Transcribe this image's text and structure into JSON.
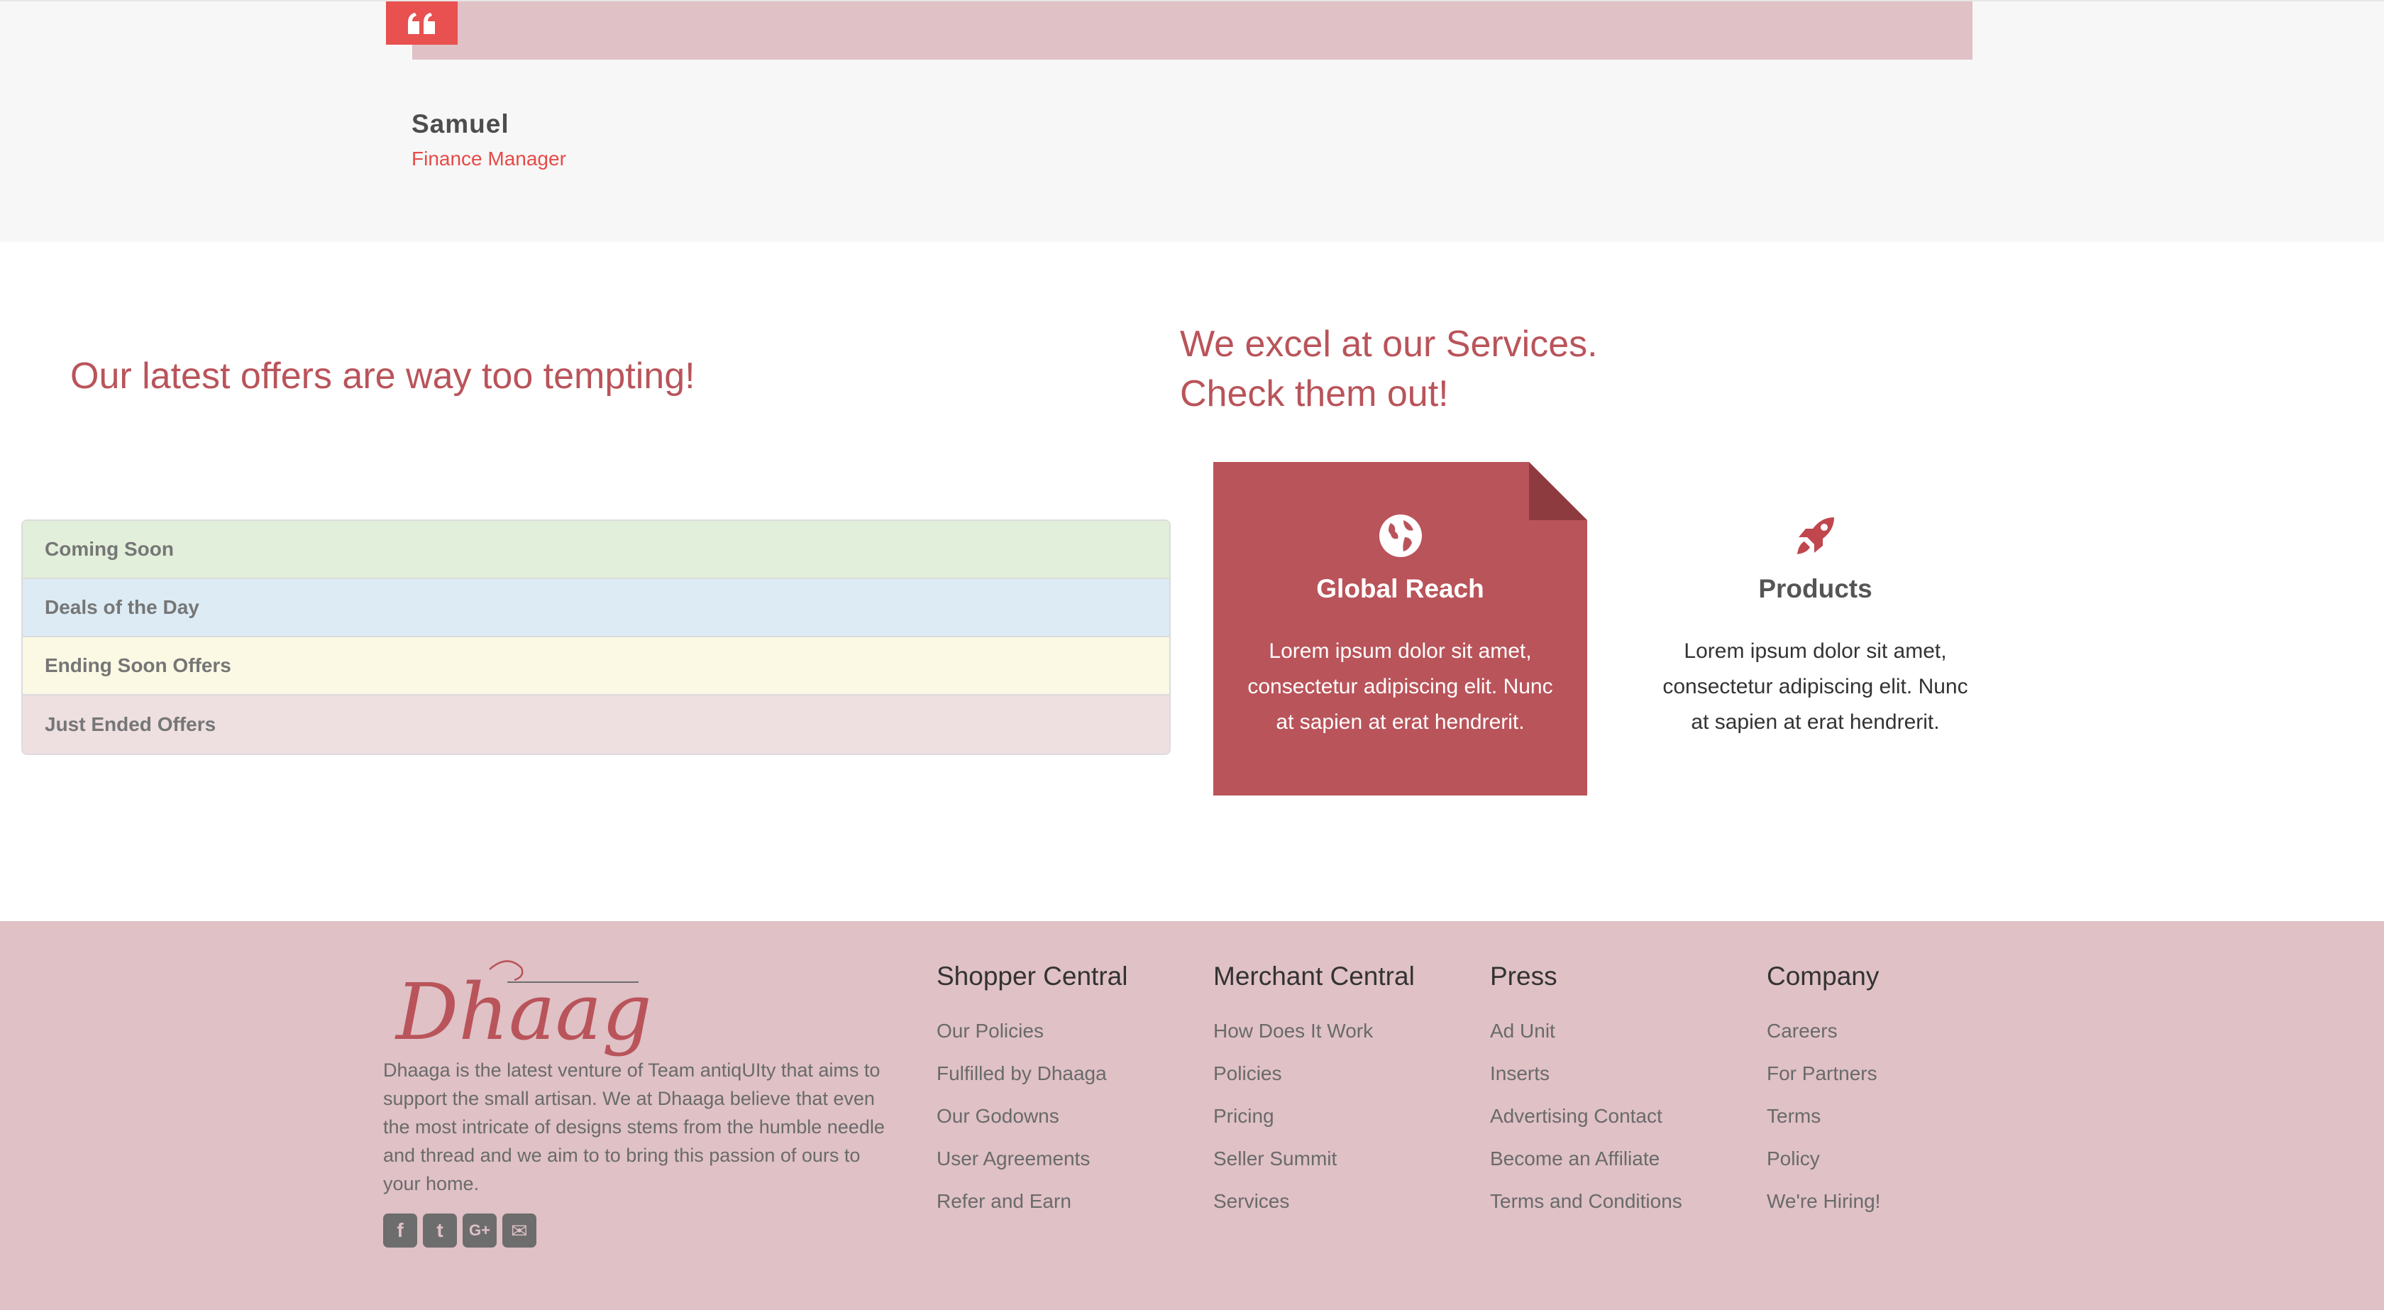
{
  "testimonial": {
    "author": "Samuel",
    "role": "Finance Manager"
  },
  "offers": {
    "title": "Our latest offers are way too tempting!",
    "items": [
      {
        "label": "Coming Soon",
        "color": "#e2efda"
      },
      {
        "label": "Deals of the Day",
        "color": "#dcebf4"
      },
      {
        "label": "Ending Soon Offers",
        "color": "#fbf8e4"
      },
      {
        "label": "Just Ended Offers",
        "color": "#eedfe1"
      }
    ]
  },
  "services": {
    "title_line1": "We excel at our Services.",
    "title_line2": "Check them out!",
    "cards": [
      {
        "icon": "globe-icon",
        "title": "Global Reach",
        "text": "Lorem ipsum dolor sit amet, consectetur adipiscing elit. Nunc at sapien at erat hendrerit."
      },
      {
        "icon": "rocket-icon",
        "title": "Products",
        "text": "Lorem ipsum dolor sit amet, consectetur adipiscing elit. Nunc at sapien at erat hendrerit."
      }
    ]
  },
  "footer": {
    "brand": "Dhaaga",
    "about": "Dhaaga is the latest venture of Team antiqUIty that aims to support the small artisan. We at Dhaaga believe that even the most intricate of designs stems from the humble needle and thread and we aim to to bring this passion of ours to your home.",
    "social": [
      {
        "icon": "facebook-icon",
        "glyph": "f"
      },
      {
        "icon": "twitter-icon",
        "glyph": "t"
      },
      {
        "icon": "google-plus-icon",
        "glyph": "G+"
      },
      {
        "icon": "email-icon",
        "glyph": "✉"
      }
    ],
    "columns": [
      {
        "title": "Shopper Central",
        "links": [
          "Our Policies",
          "Fulfilled by Dhaaga",
          "Our Godowns",
          "User Agreements",
          "Refer and Earn"
        ]
      },
      {
        "title": "Merchant Central",
        "links": [
          "How Does It Work",
          "Policies",
          "Pricing",
          "Seller Summit",
          "Services"
        ]
      },
      {
        "title": "Press",
        "links": [
          "Ad Unit",
          "Inserts",
          "Advertising Contact",
          "Become an Affiliate",
          "Terms and Conditions"
        ]
      },
      {
        "title": "Company",
        "links": [
          "Careers",
          "For Partners",
          "Terms",
          "Policy",
          "We're Hiring!"
        ]
      }
    ]
  }
}
